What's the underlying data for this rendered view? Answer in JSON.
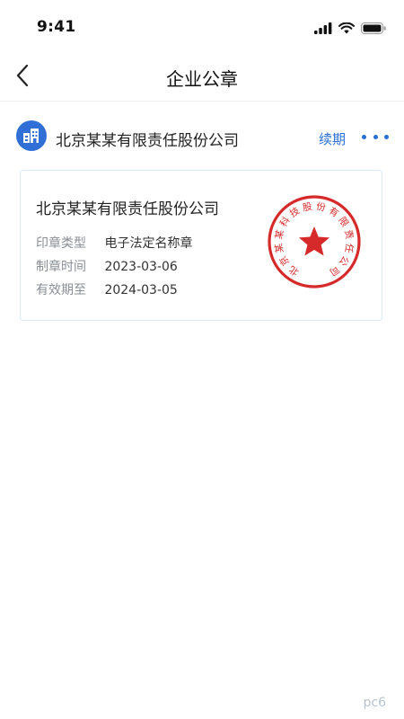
{
  "status_bar": {
    "time": "9:41"
  },
  "nav": {
    "title": "企业公章"
  },
  "company": {
    "name": "北京某某有限责任股份公司",
    "renew_label": "续期"
  },
  "seal_card": {
    "title": "北京某某有限责任股份公司",
    "rows": [
      {
        "label": "印章类型",
        "value": "电子法定名称章"
      },
      {
        "label": "制章时间",
        "value": "2023-03-06"
      },
      {
        "label": "有效期至",
        "value": "2024-03-05"
      }
    ],
    "seal_text": "北京某某科技股份有限责任公司",
    "seal_color": "#d62a2a"
  },
  "watermark": "pc6"
}
